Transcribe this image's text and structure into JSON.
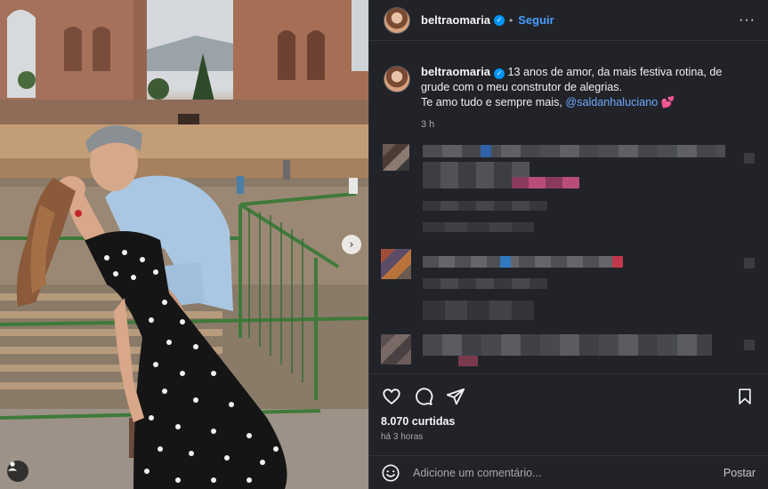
{
  "post": {
    "username": "beltraomaria",
    "follow_label": "Seguir",
    "caption_line1": "13 anos de amor, da mais festiva rotina, de grude com o meu construtor de alegrias.",
    "caption_line2": "Te amo tudo e sempre mais, ",
    "mention": "@saldanhaluciano",
    "heart": "💕",
    "caption_age": "3 h",
    "likes": "8.070 curtidas",
    "date": "há 3 horas"
  },
  "comment_box": {
    "placeholder": "Adicione um comentário...",
    "post_label": "Postar"
  },
  "colors": {
    "panel_bg": "#212328",
    "accent_blue": "#0095f6",
    "link_blue": "#6fa8ff"
  },
  "icons": {
    "like": "heart-icon",
    "comment": "comment-icon",
    "share": "share-icon",
    "save": "bookmark-icon",
    "emoji": "emoji-icon",
    "more": "more-options-icon",
    "user": "user-tag-icon",
    "next": "chevron-right-icon"
  }
}
